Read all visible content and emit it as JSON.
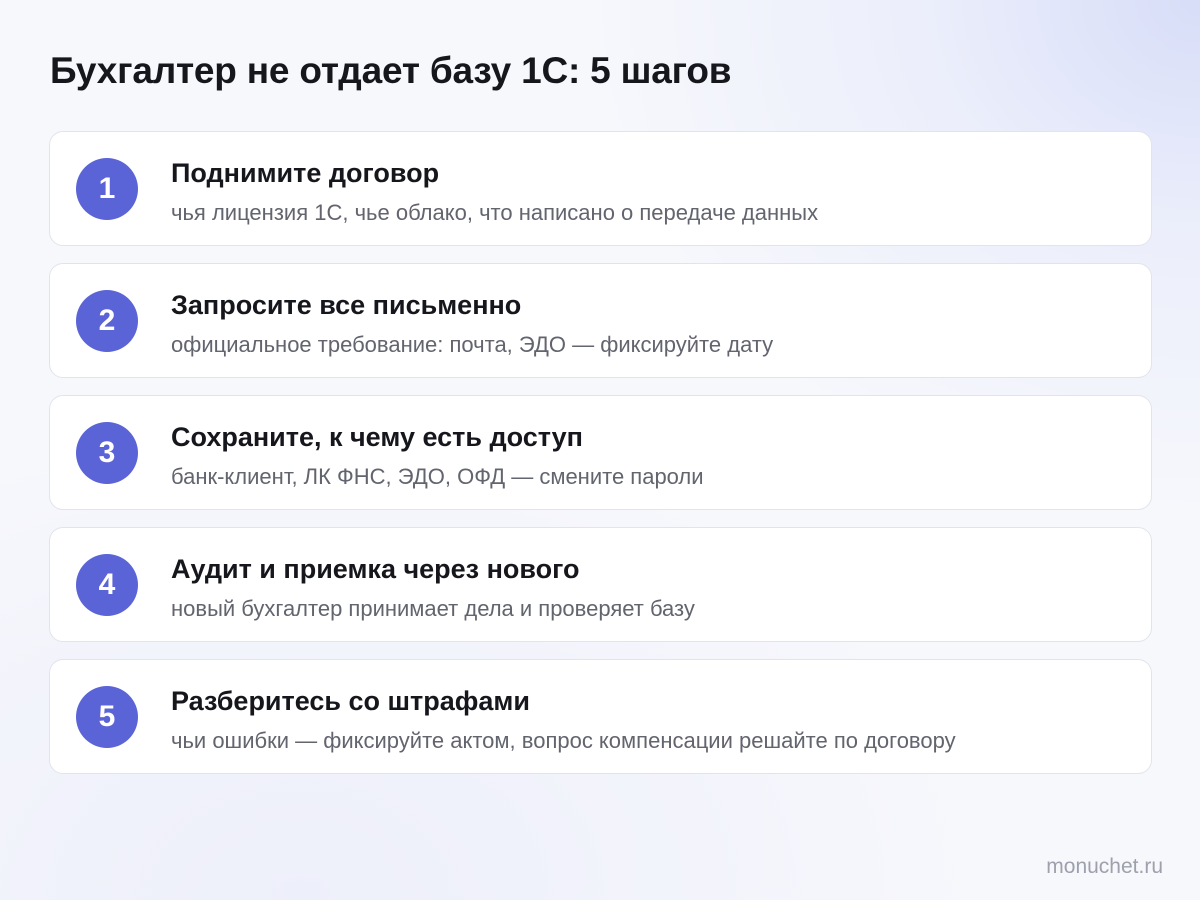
{
  "title": "Бухгалтер не отдает базу 1С: 5 шагов",
  "steps": [
    {
      "number": "1",
      "title": "Поднимите договор",
      "description": "чья лицензия 1С, чье облако, что написано о передаче данных"
    },
    {
      "number": "2",
      "title": "Запросите все письменно",
      "description": "официальное требование: почта, ЭДО — фиксируйте дату"
    },
    {
      "number": "3",
      "title": "Сохраните, к чему есть доступ",
      "description": "банк-клиент, ЛК ФНС, ЭДО, ОФД — смените пароли"
    },
    {
      "number": "4",
      "title": "Аудит и приемка через нового",
      "description": "новый бухгалтер принимает дела и проверяет базу"
    },
    {
      "number": "5",
      "title": "Разберитесь со штрафами",
      "description": "чьи ошибки — фиксируйте актом, вопрос компенсации решайте по договору"
    }
  ],
  "footer": {
    "domain": "monuchet.ru"
  },
  "colors": {
    "accent": "#5b64d6",
    "text": "#16171c",
    "muted_text": "#62646e",
    "card_border": "#e2e4ec"
  }
}
